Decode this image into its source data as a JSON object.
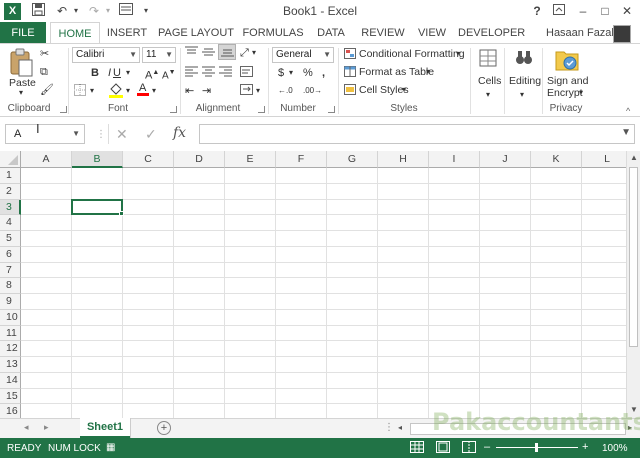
{
  "app": {
    "window_title": "Book1 - Excel",
    "logo_letter": "X"
  },
  "quick_access": {
    "save_icon": "save-icon",
    "undo_icon": "undo-icon",
    "redo_icon": "redo-icon",
    "customize_icon": "quick-access-customize-icon"
  },
  "window_controls": {
    "help": "?",
    "restore_ribbon": "ribbon-display-icon",
    "minimize": "–",
    "maximize": "□",
    "close": "✕"
  },
  "tabs": [
    "FILE",
    "HOME",
    "INSERT",
    "PAGE LAYOUT",
    "FORMULAS",
    "DATA",
    "REVIEW",
    "VIEW",
    "DEVELOPER"
  ],
  "active_tab": "HOME",
  "user": {
    "name": "Hasaan Fazal"
  },
  "ribbon": {
    "clipboard": {
      "label": "Clipboard",
      "paste": "Paste"
    },
    "font": {
      "label": "Font",
      "font_name": "Calibri",
      "font_size": "11",
      "bold": "B",
      "italic": "I",
      "underline": "U",
      "grow": "A",
      "shrink": "A",
      "fill_color": "#ffff00",
      "font_color": "#ff0000"
    },
    "alignment": {
      "label": "Alignment"
    },
    "number": {
      "label": "Number",
      "format": "General",
      "currency": "$",
      "percent": "%",
      "comma": ","
    },
    "styles": {
      "label": "Styles",
      "conditional": "Conditional Formatting",
      "format_table": "Format as Table",
      "cell_styles": "Cell Styles"
    },
    "cells": {
      "label": "Cells"
    },
    "editing": {
      "label": "Editing"
    },
    "privacy": {
      "label": "Privacy",
      "sign_line1": "Sign and",
      "sign_line2": "Encrypt"
    }
  },
  "formula_bar": {
    "name_box": "A",
    "cancel": "✕",
    "enter": "✓",
    "fx": "fx",
    "formula": ""
  },
  "grid": {
    "columns": [
      "A",
      "B",
      "C",
      "D",
      "E",
      "F",
      "G",
      "H",
      "I",
      "J",
      "K",
      "L"
    ],
    "rows": [
      "1",
      "2",
      "3",
      "4",
      "5",
      "6",
      "7",
      "8",
      "9",
      "10",
      "11",
      "12",
      "13",
      "14",
      "15",
      "16"
    ],
    "selected_column": "B",
    "selected_row": "3"
  },
  "sheets": {
    "tabs": [
      "Sheet1"
    ],
    "active": "Sheet1",
    "add": "+"
  },
  "status": {
    "ready": "READY",
    "num_lock": "NUM LOCK",
    "zoom": "100%",
    "zoom_minus": "–",
    "zoom_plus": "+"
  },
  "watermark": "Pakaccountants.com",
  "colors": {
    "accent": "#217346",
    "header_bg": "#f3f3f3",
    "gridline": "#e1e1e1"
  }
}
